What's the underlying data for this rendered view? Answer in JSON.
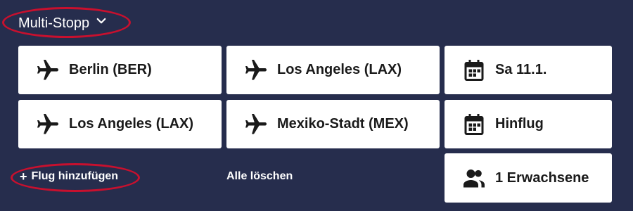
{
  "trip_type": {
    "label": "Multi-Stopp",
    "icon": "chevron-down-icon"
  },
  "legs": [
    {
      "origin": "Berlin (BER)",
      "destination": "Los Angeles (LAX)",
      "date": "Sa 11.1."
    },
    {
      "origin": "Los Angeles (LAX)",
      "destination": "Mexiko-Stadt (MEX)",
      "date": "Hinflug"
    }
  ],
  "actions": {
    "add_flight": "Flug hinzufügen",
    "add_flight_icon": "plus-icon",
    "clear_all": "Alle löschen"
  },
  "passengers": {
    "label": "1 Erwachsene",
    "icon": "people-icon"
  },
  "icons": {
    "airport": "airplane-icon",
    "date": "calendar-icon"
  },
  "colors": {
    "background": "#262d4d",
    "field_bg": "#ffffff",
    "highlight": "#c8102e"
  }
}
